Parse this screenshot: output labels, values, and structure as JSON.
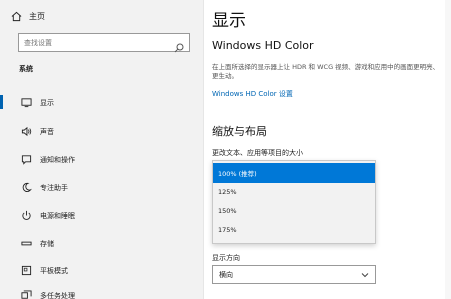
{
  "sidebar": {
    "home_label": "主页",
    "search_placeholder": "查找设置",
    "section_title": "系统",
    "items": [
      {
        "label": "显示",
        "icon": "monitor-icon",
        "active": true
      },
      {
        "label": "声音",
        "icon": "speaker-icon"
      },
      {
        "label": "通知和操作",
        "icon": "notification-icon"
      },
      {
        "label": "专注助手",
        "icon": "moon-icon"
      },
      {
        "label": "电源和睡眠",
        "icon": "power-icon"
      },
      {
        "label": "存储",
        "icon": "storage-icon"
      },
      {
        "label": "平板模式",
        "icon": "tablet-icon"
      },
      {
        "label": "多任务处理",
        "icon": "multitask-icon"
      }
    ]
  },
  "main": {
    "title": "显示",
    "hdr_heading": "Windows HD Color",
    "hdr_desc": "在上面所选择的显示器上让 HDR 和 WCG 视频、游戏和应用中的画面更明亮、更生动。",
    "hdr_link": "Windows HD Color 设置",
    "layout_heading": "缩放与布局",
    "scale_label": "更改文本、应用等项目的大小",
    "scale_options": [
      {
        "label": "100% (推荐)",
        "selected": true
      },
      {
        "label": "125%"
      },
      {
        "label": "150%"
      },
      {
        "label": "175%"
      }
    ],
    "orientation_label": "显示方向",
    "orientation_value": "横向"
  },
  "colors": {
    "accent": "#0078d7",
    "link": "#0066b4",
    "sidebar_bg": "#f2f2f2"
  }
}
